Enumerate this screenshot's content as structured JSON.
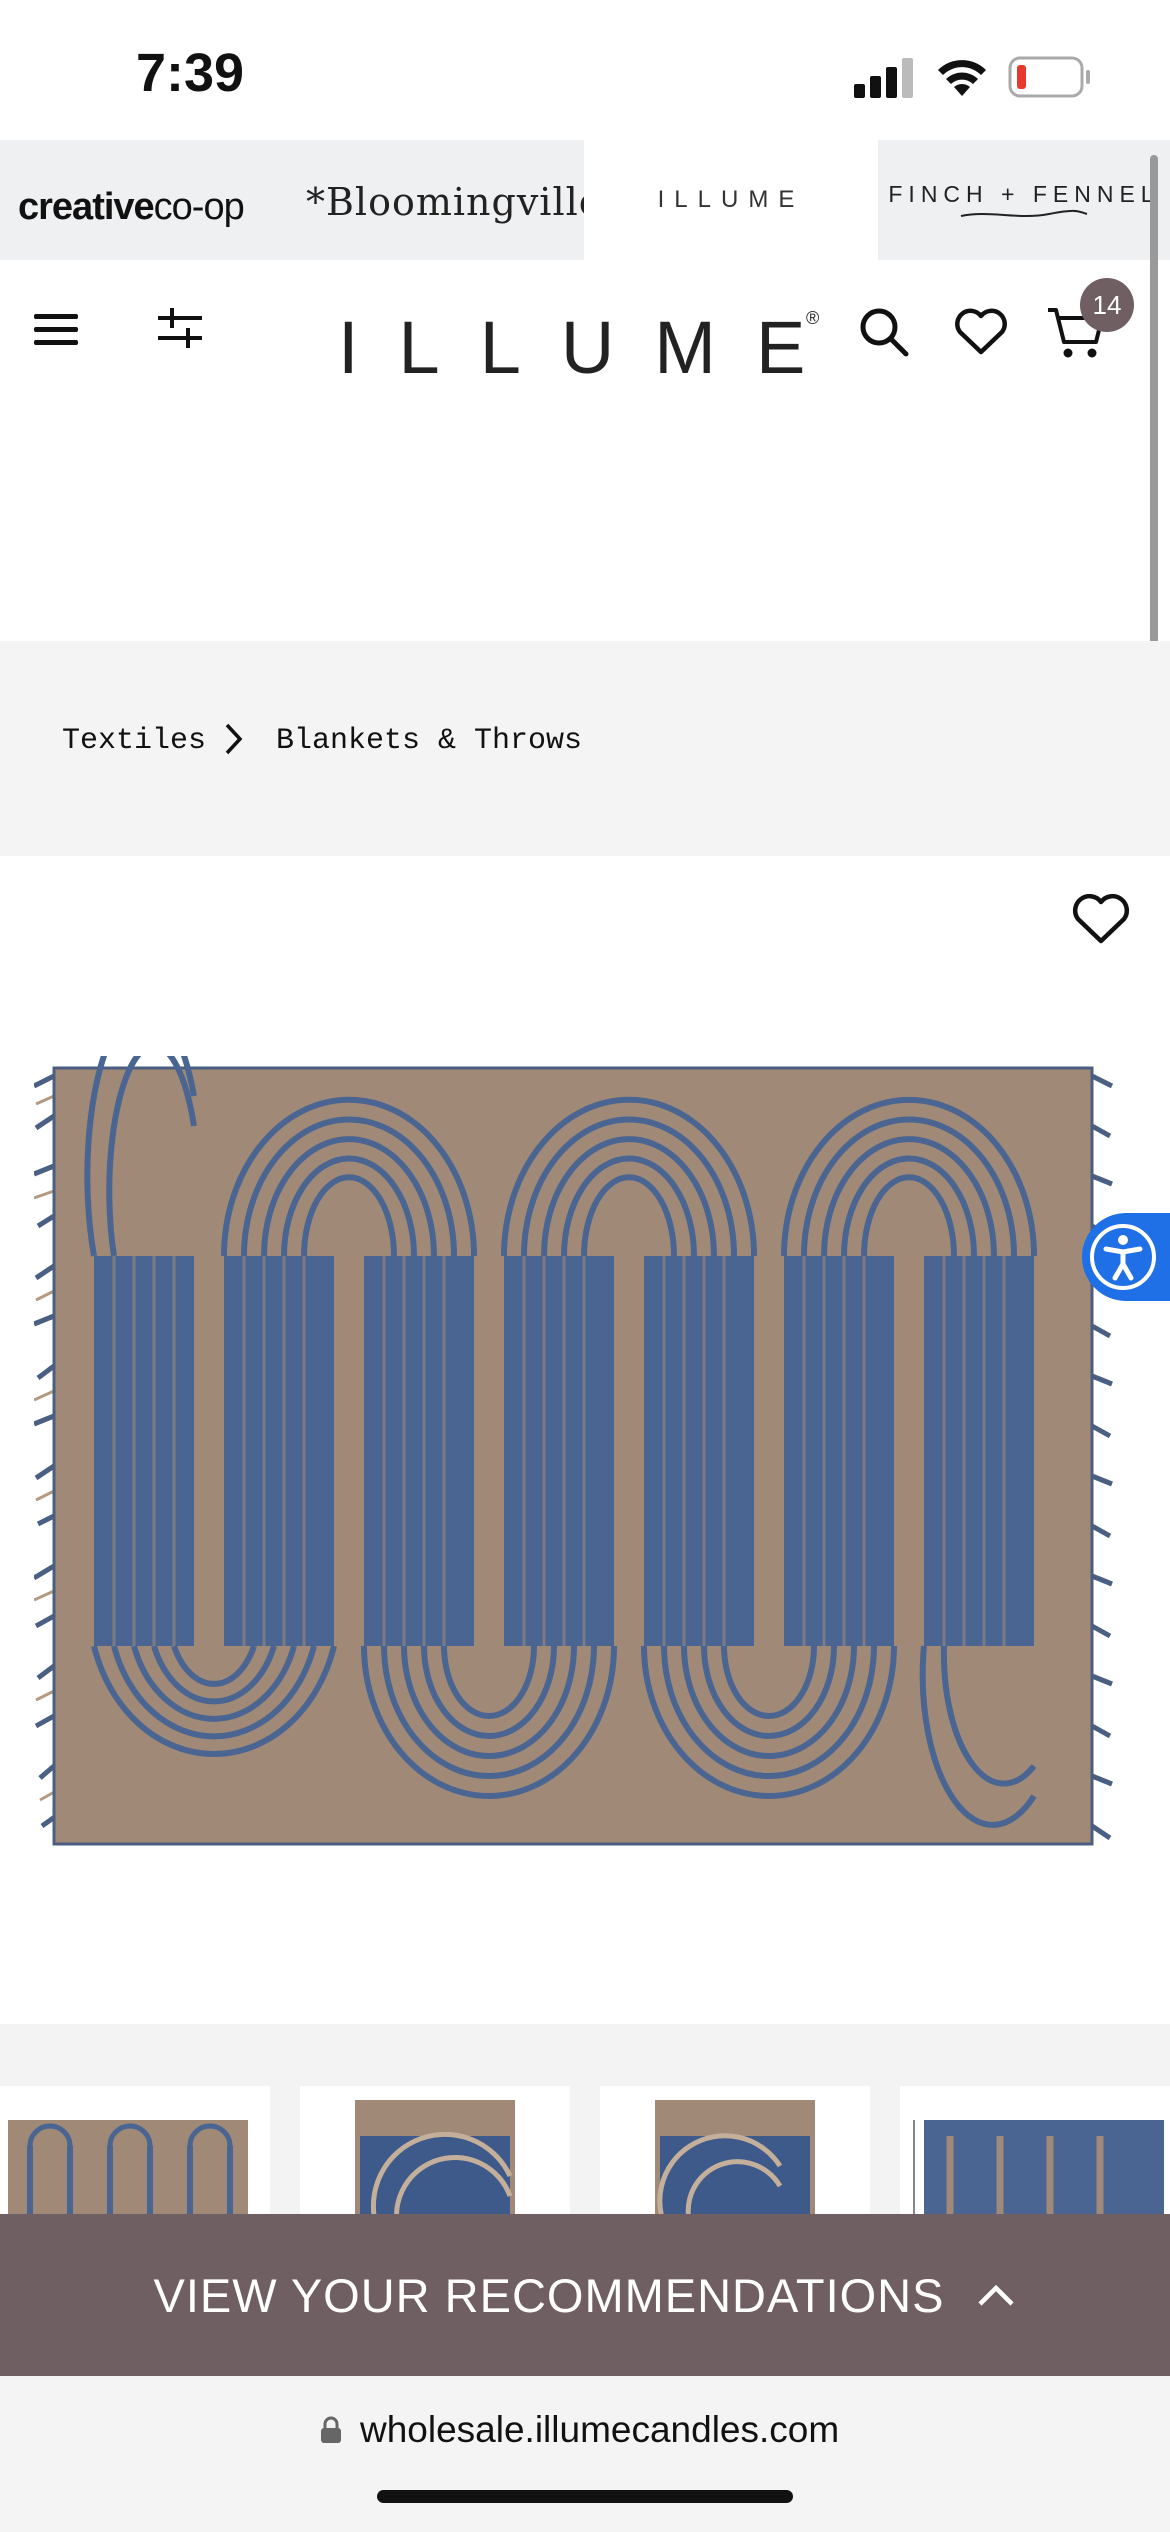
{
  "status_bar": {
    "time": "7:39"
  },
  "brands": {
    "creative_bold": "creative",
    "creative_light": "co-op",
    "bloomingville": "*Bloomingville",
    "illume": "ILLUME",
    "finch": "FINCH + FENNEL"
  },
  "header": {
    "logo": "ILLUME",
    "cart_count": "14"
  },
  "breadcrumb": {
    "items": [
      "Textiles",
      "Blankets & Throws"
    ]
  },
  "recommendations": {
    "label": "VIEW YOUR RECOMMENDATIONS"
  },
  "browser": {
    "url": "wholesale.illumecandles.com"
  },
  "colors": {
    "accent": "#6f5f62",
    "accessibility": "#1f6fe6",
    "blanket_tan": "#a08a77",
    "blanket_blue": "#4a6591"
  },
  "icons": [
    "signal-icon",
    "wifi-icon",
    "battery-icon",
    "menu-icon",
    "filter-icon",
    "search-icon",
    "heart-icon",
    "cart-icon",
    "chevron-right-icon",
    "accessibility-icon",
    "chevron-up-icon",
    "lock-icon"
  ]
}
